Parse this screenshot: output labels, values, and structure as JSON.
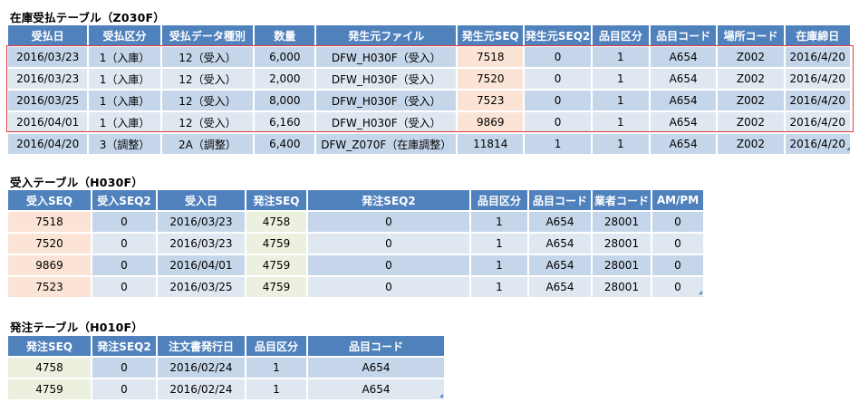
{
  "z030f": {
    "title": "在庫受払テーブル（Z030F）",
    "headers": [
      "受払日",
      "受払区分",
      "受払データ種別",
      "数量",
      "発生元ファイル",
      "発生元SEQ",
      "発生元SEQ2",
      "品目区分",
      "品目コード",
      "場所コード",
      "在庫締日"
    ],
    "rows": [
      [
        "2016/03/23",
        "1（入庫）",
        "12（受入）",
        "6,000",
        "DFW_H030F（受入）",
        "7518",
        "0",
        "1",
        "A654",
        "Z002",
        "2016/4/20"
      ],
      [
        "2016/03/23",
        "1（入庫）",
        "12（受入）",
        "2,000",
        "DFW_H030F（受入）",
        "7520",
        "0",
        "1",
        "A654",
        "Z002",
        "2016/4/20"
      ],
      [
        "2016/03/25",
        "1（入庫）",
        "12（受入）",
        "8,000",
        "DFW_H030F（受入）",
        "7523",
        "0",
        "1",
        "A654",
        "Z002",
        "2016/4/20"
      ],
      [
        "2016/04/01",
        "1（入庫）",
        "12（受入）",
        "6,160",
        "DFW_H030F（受入）",
        "9869",
        "0",
        "1",
        "A654",
        "Z002",
        "2016/4/20"
      ],
      [
        "2016/04/20",
        "3（調整）",
        "2A（調整）",
        "6,400",
        "DFW_Z070F（在庫調整）",
        "11814",
        "1",
        "1",
        "A654",
        "Z002",
        "2016/4/20"
      ]
    ]
  },
  "h030f": {
    "title": "受入テーブル（H030F）",
    "headers": [
      "受入SEQ",
      "受入SEQ2",
      "受入日",
      "発注SEQ",
      "発注SEQ2",
      "品目区分",
      "品目コード",
      "業者コード",
      "AM/PM"
    ],
    "rows": [
      [
        "7518",
        "0",
        "2016/03/23",
        "4758",
        "0",
        "1",
        "A654",
        "28001",
        "0"
      ],
      [
        "7520",
        "0",
        "2016/03/23",
        "4759",
        "0",
        "1",
        "A654",
        "28001",
        "0"
      ],
      [
        "9869",
        "0",
        "2016/04/01",
        "4759",
        "0",
        "1",
        "A654",
        "28001",
        "0"
      ],
      [
        "7523",
        "0",
        "2016/03/25",
        "4759",
        "0",
        "1",
        "A654",
        "28001",
        "0"
      ]
    ]
  },
  "h010f": {
    "title": "発注テーブル（H010F）",
    "headers": [
      "発注SEQ",
      "発注SEQ2",
      "注文書発行日",
      "品目区分",
      "品目コード"
    ],
    "rows": [
      [
        "4758",
        "0",
        "2016/02/24",
        "1",
        "A654"
      ],
      [
        "4759",
        "0",
        "2016/02/24",
        "1",
        "A654"
      ]
    ]
  },
  "colors": {
    "header": "#4f81bd",
    "row_odd": "#c6d6ea",
    "row_even": "#dfe7f1",
    "seq_highlight": "#fbe4d5",
    "order_seq_highlight": "#ebf1de",
    "selection_border": "#e0393b"
  }
}
